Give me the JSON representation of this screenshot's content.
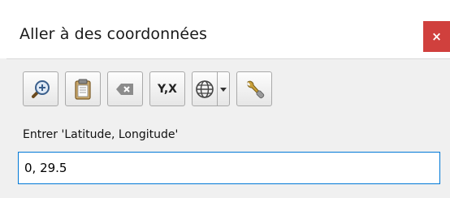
{
  "dialog": {
    "title": "Aller à des coordonnées",
    "close_label": "×"
  },
  "toolbar": {
    "buttons": [
      {
        "icon": "zoom-to-icon"
      },
      {
        "icon": "paste-icon"
      },
      {
        "icon": "clear-icon"
      },
      {
        "icon": "swap-xy-icon",
        "label": "Y,X"
      },
      {
        "icon": "globe-icon"
      },
      {
        "icon": "dropdown-arrow-icon"
      },
      {
        "icon": "wrench-icon"
      }
    ]
  },
  "input": {
    "label": "Entrer 'Latitude, Longitude'",
    "value": "0, 29.5"
  },
  "colors": {
    "close_bg": "#d0403d",
    "input_border": "#0078d7"
  }
}
